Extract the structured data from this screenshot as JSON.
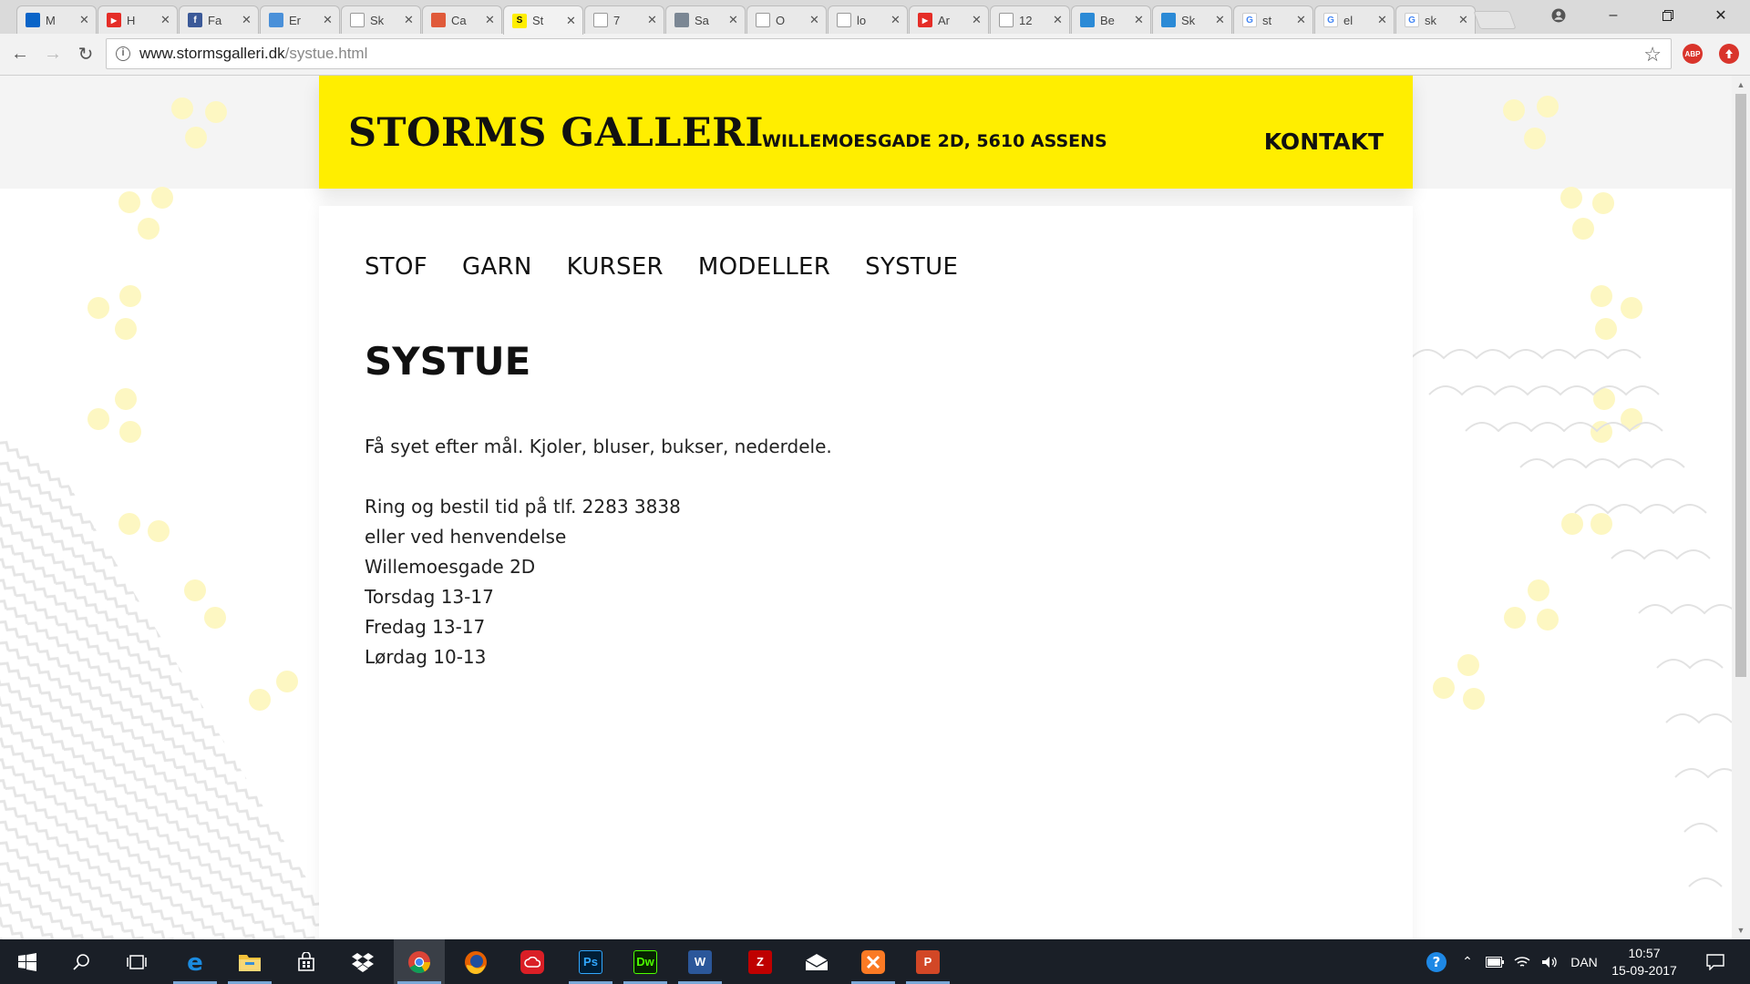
{
  "browser": {
    "tabs": [
      {
        "title": "M",
        "icon": "outlook-icon",
        "color": "#0a64c8"
      },
      {
        "title": "H",
        "icon": "youtube-icon",
        "color": "#e52d27"
      },
      {
        "title": "Fa",
        "icon": "facebook-icon",
        "color": "#3b5998"
      },
      {
        "title": "Er",
        "icon": "arrow-icon",
        "color": "#4a90d9"
      },
      {
        "title": "Sk",
        "icon": "page-icon",
        "color": "#9e9e9e"
      },
      {
        "title": "Ca",
        "icon": "gear-icon",
        "color": "#e05a3a"
      },
      {
        "title": "St",
        "icon": "storms-s-icon",
        "color": "#ffee00"
      },
      {
        "title": "7",
        "icon": "page-icon",
        "color": "#9e9e9e"
      },
      {
        "title": "Sa",
        "icon": "image-icon",
        "color": "#7b8794"
      },
      {
        "title": "O",
        "icon": "page-icon",
        "color": "#9e9e9e"
      },
      {
        "title": "lo",
        "icon": "page-icon",
        "color": "#9e9e9e"
      },
      {
        "title": "Ar",
        "icon": "youtube-icon",
        "color": "#e52d27"
      },
      {
        "title": "12",
        "icon": "page-icon",
        "color": "#9e9e9e"
      },
      {
        "title": "Be",
        "icon": "x-app-icon",
        "color": "#2b8ad6"
      },
      {
        "title": "Sk",
        "icon": "x-app-icon",
        "color": "#2b8ad6"
      },
      {
        "title": "st",
        "icon": "google-icon",
        "color": "#4285f4"
      },
      {
        "title": "el",
        "icon": "google-icon",
        "color": "#4285f4"
      },
      {
        "title": "sk",
        "icon": "google-icon",
        "color": "#4285f4"
      }
    ],
    "active_tab_index": 6,
    "url_host": "www.stormsgalleri.dk",
    "url_path": "/systue.html",
    "extensions": [
      {
        "name": "adblock-icon",
        "label": "ABP",
        "color": "#d9342b"
      },
      {
        "name": "extension-icon",
        "label": "",
        "color": "#d9342b"
      }
    ]
  },
  "site": {
    "logo": "STORMS GALLERI",
    "address": "WILLEMOESGADE 2D, 5610 ASSENS",
    "contact_link": "KONTAKT",
    "nav": [
      "STOF",
      "GARN",
      "KURSER",
      "MODELLER",
      "SYSTUE"
    ],
    "page_title": "SYSTUE",
    "intro": "Få syet efter mål. Kjoler, bluser, bukser, nederdele.",
    "info_lines": [
      "Ring og bestil tid på tlf. 2283 3838",
      "eller ved henvendelse",
      "Willemoesgade 2D",
      "Torsdag 13-17",
      "Fredag 13-17",
      "Lørdag 10-13"
    ],
    "brand_color": "#ffee00",
    "dot_color": "#fdf7c2"
  },
  "taskbar": {
    "apps": [
      {
        "name": "start-icon",
        "label": "",
        "color": "#ffffff"
      },
      {
        "name": "search-icon",
        "label": "",
        "color": "#ffffff"
      },
      {
        "name": "task-view-icon",
        "label": "",
        "color": "#ffffff"
      },
      {
        "name": "edge-icon",
        "label": "e",
        "color": "#1b8be0"
      },
      {
        "name": "file-explorer-icon",
        "label": "",
        "color": "#f3c13a"
      },
      {
        "name": "store-icon",
        "label": "",
        "color": "#ffffff"
      },
      {
        "name": "dropbox-icon",
        "label": "",
        "color": "#ffffff"
      },
      {
        "name": "chrome-icon",
        "label": "",
        "color": "#e34133"
      },
      {
        "name": "firefox-icon",
        "label": "",
        "color": "#e66000"
      },
      {
        "name": "creative-cloud-icon",
        "label": "",
        "color": "#da1f26"
      },
      {
        "name": "photoshop-icon",
        "label": "Ps",
        "color": "#001e36"
      },
      {
        "name": "dreamweaver-icon",
        "label": "Dw",
        "color": "#072401"
      },
      {
        "name": "word-icon",
        "label": "W",
        "color": "#2b579a"
      },
      {
        "name": "filezilla-icon",
        "label": "Z",
        "color": "#bf0000"
      },
      {
        "name": "mail-icon",
        "label": "",
        "color": "#ffffff"
      },
      {
        "name": "xampp-icon",
        "label": "",
        "color": "#fb7a24"
      },
      {
        "name": "powerpoint-icon",
        "label": "P",
        "color": "#d24726"
      }
    ],
    "language": "DAN",
    "time": "10:57",
    "date": "15-09-2017"
  }
}
